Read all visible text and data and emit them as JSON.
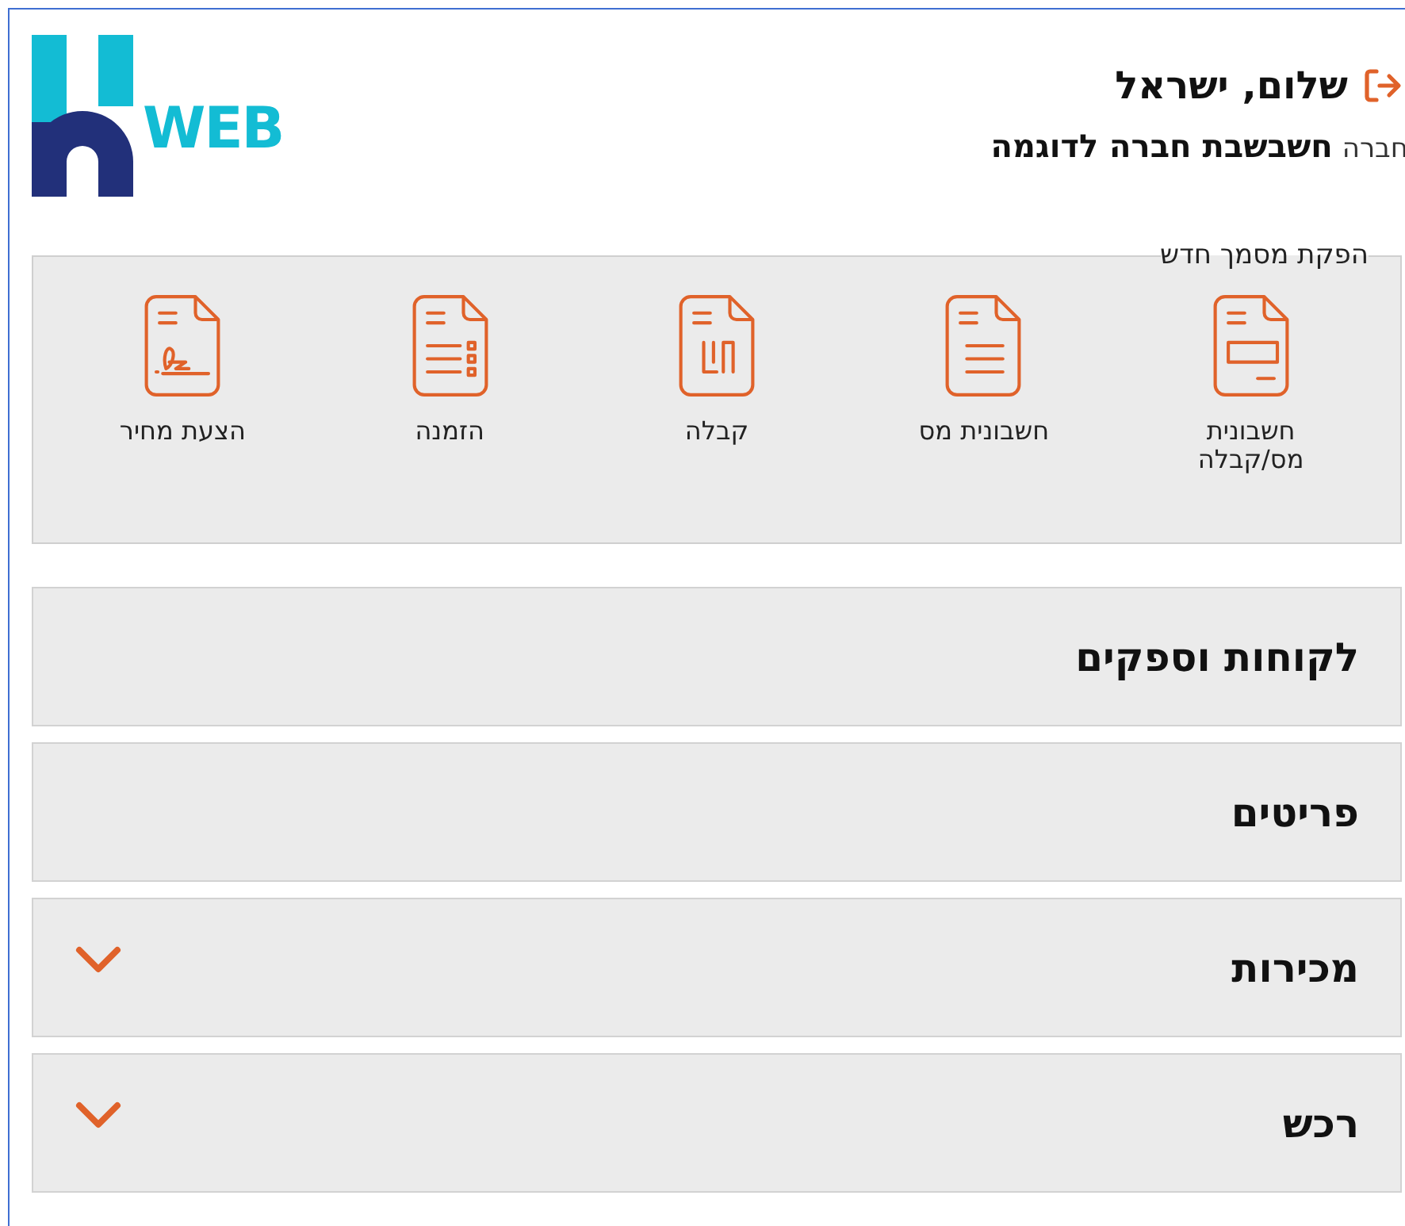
{
  "logo": {
    "text": "WEB"
  },
  "header": {
    "greeting": "שלום, ישראל",
    "company_label": "חברה",
    "company_name": "חשבשבת חברה לדוגמה"
  },
  "new_document": {
    "title": "הפקת מסמך חדש",
    "items": [
      {
        "kind": "invoice_receipt",
        "label": "חשבונית מס/קבלה"
      },
      {
        "kind": "tax_invoice",
        "label": "חשבונית מס"
      },
      {
        "kind": "receipt",
        "label": "קבלה"
      },
      {
        "kind": "order",
        "label": "הזמנה"
      },
      {
        "kind": "quote",
        "label": "הצעת מחיר"
      }
    ]
  },
  "sections": [
    {
      "title": "לקוחות וספקים",
      "expandable": false
    },
    {
      "title": "פריטים",
      "expandable": false
    },
    {
      "title": "מכירות",
      "expandable": true
    },
    {
      "title": "רכש",
      "expandable": true
    }
  ]
}
